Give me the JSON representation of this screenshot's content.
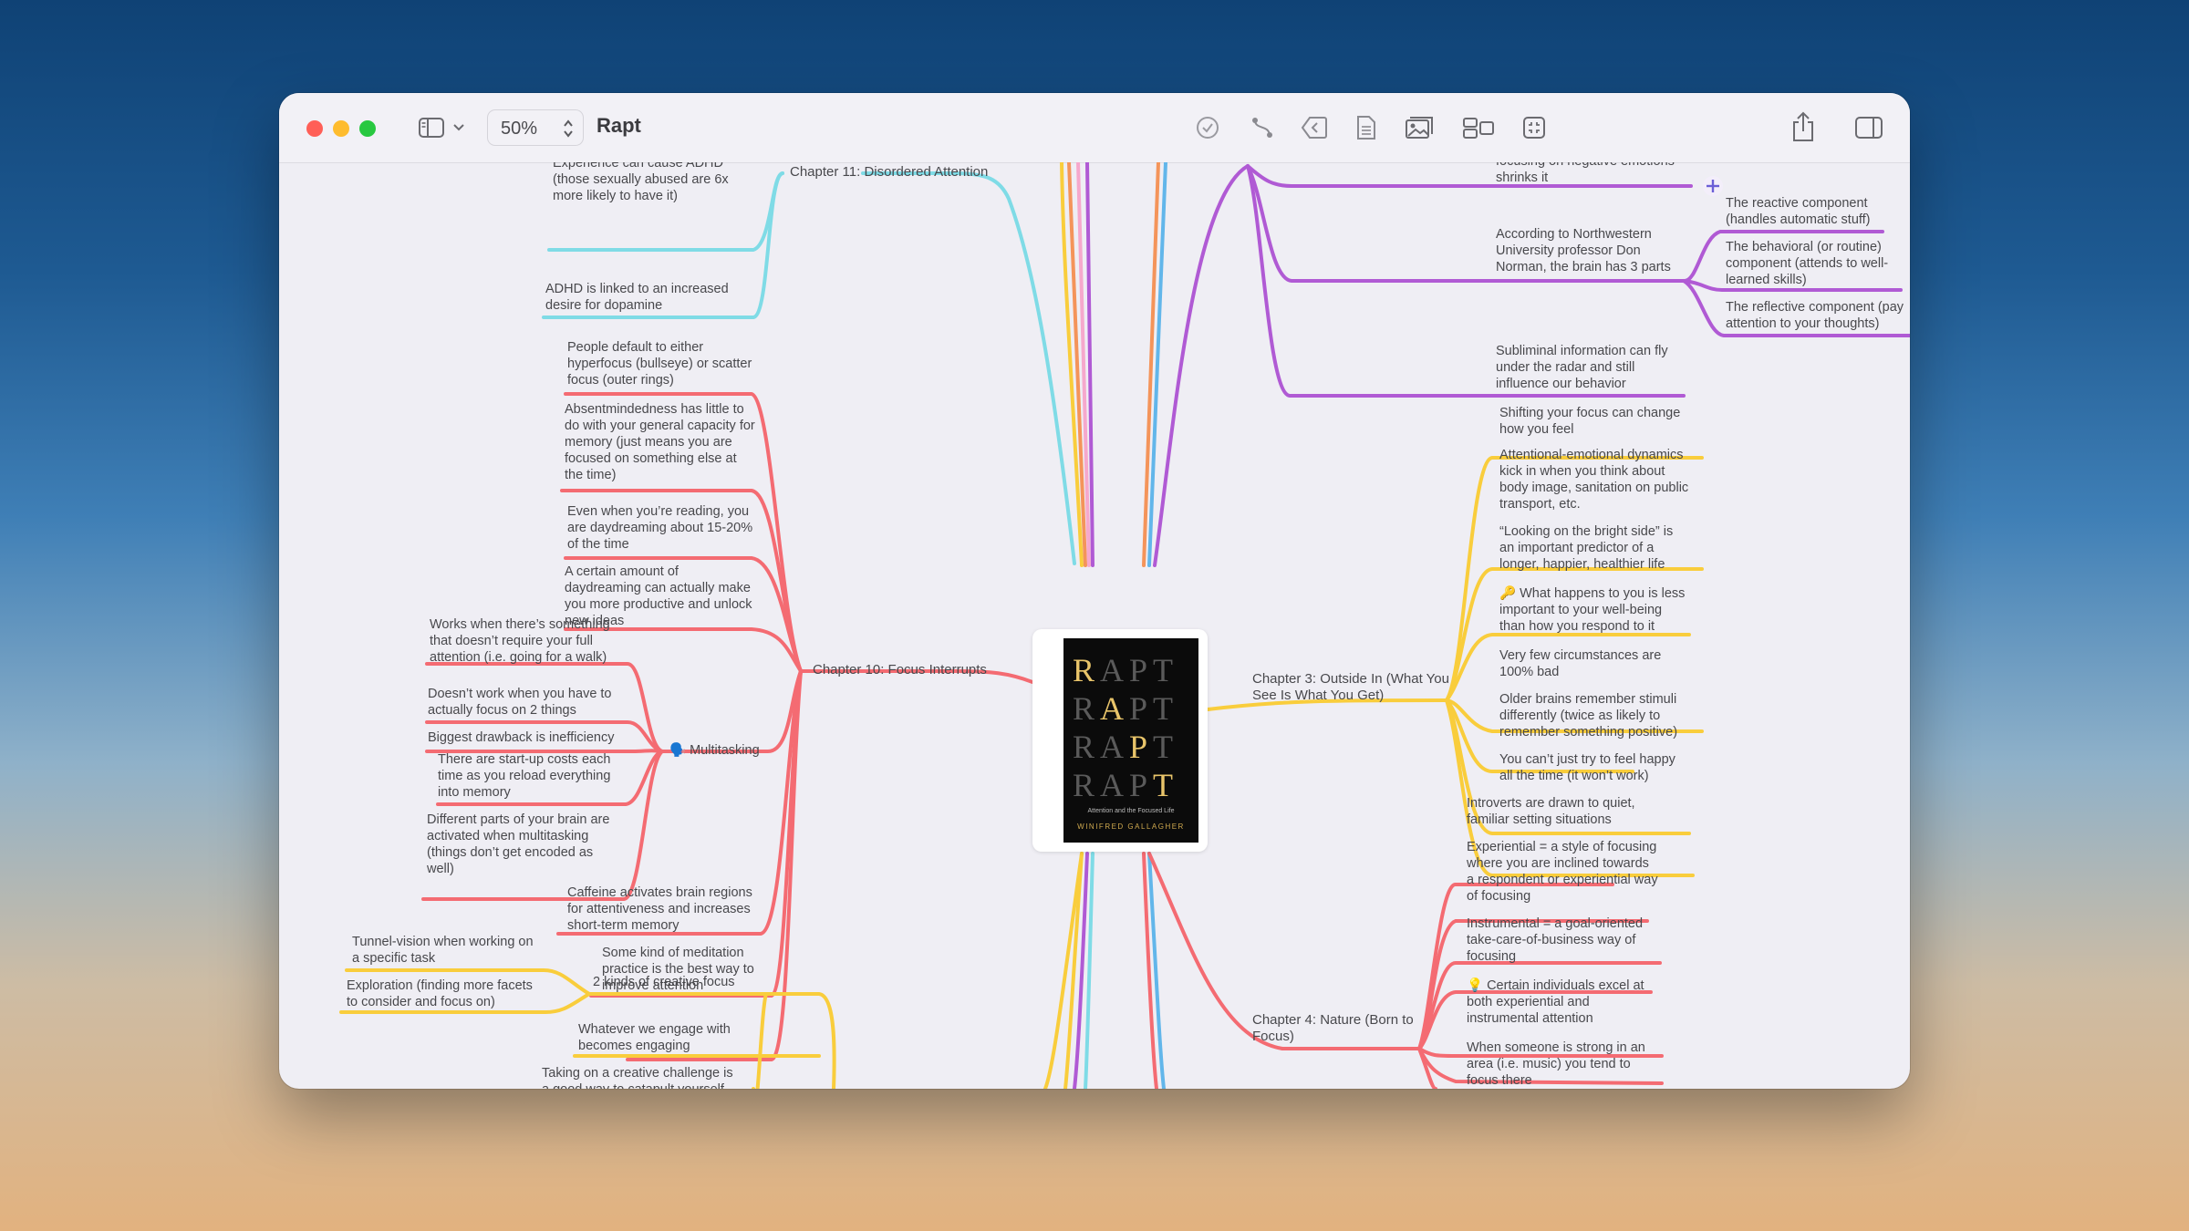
{
  "window": {
    "title": "Rapt",
    "zoom": "50%"
  },
  "toolbar": {
    "left_icons": [
      "sidebar-icon",
      "chevron-down-icon"
    ],
    "center_icons": [
      "checkmark-icon",
      "connection-icon",
      "back-icon",
      "note-icon",
      "image-icon",
      "layout-icon",
      "focus-icon"
    ],
    "right_icons": [
      "share-icon",
      "inspector-icon"
    ]
  },
  "colors": {
    "cyan": "#7fdbe6",
    "red": "#f46b72",
    "yellow": "#f9cd3c",
    "purple": "#b05ad4",
    "orange": "#f4945a",
    "blue": "#62b6ea",
    "background": "#efeef4"
  },
  "book": {
    "title_rows": [
      "RAPT",
      "RAPT",
      "RAPT",
      "RAPT"
    ],
    "subtitle": "Attention and the Focused Life",
    "author": "WINIFRED GALLAGHER"
  },
  "chapters": {
    "ch11": "Chapter 11: Disordered Attention",
    "ch10": "Chapter 10: Focus Interrupts",
    "ch3": [
      "Chapter 3: Outside In (What You",
      "See Is What You Get)"
    ],
    "ch4": [
      "Chapter 4: Nature (Born to",
      "Focus)"
    ]
  },
  "ch11_nodes": {
    "n1": [
      "Experience can cause ADHD",
      "(those sexually abused are 6x",
      "more likely to have it)"
    ],
    "n2": [
      "ADHD is linked to an increased",
      "desire for dopamine"
    ]
  },
  "ch10_nodes": {
    "n1": [
      "People default to either",
      "hyperfocus (bullseye) or scatter",
      "focus (outer rings)"
    ],
    "n2": [
      "Absentmindedness has little to",
      "do with your general capacity for",
      "memory (just means you are",
      "focused on something else at",
      "the time)"
    ],
    "n3": [
      "Even when you’re reading, you",
      "are daydreaming about 15-20%",
      "of the time"
    ],
    "n4": [
      "A certain amount of",
      "daydreaming can actually make",
      "you more productive and unlock",
      "new ideas"
    ],
    "multitasking": "🗣️ Multitasking",
    "m1": [
      "Works when there’s something",
      "that doesn’t require your full",
      "attention (i.e. going for a walk)"
    ],
    "m2": [
      "Doesn’t work when you have to",
      "actually focus on 2 things"
    ],
    "m3": [
      "Biggest drawback is inefficiency"
    ],
    "m4": [
      "There are start-up costs each",
      "time as you reload everything",
      "into memory"
    ],
    "m5": [
      "Different parts of your brain are",
      "activated when multitasking",
      "(things don’t get encoded as",
      "well)"
    ],
    "n5": [
      "Caffeine activates brain regions",
      "for attentiveness and increases",
      "short-term memory"
    ],
    "n6": [
      "Some kind of meditation",
      "practice is the best way to",
      "improve attention"
    ]
  },
  "creative_nodes": {
    "two_kinds": "2 kinds of creative focus",
    "c1": [
      "Tunnel-vision when working on",
      "a specific task"
    ],
    "c2": [
      "Exploration (finding more facets",
      "to consider and focus on)"
    ],
    "c3": [
      "Whatever we engage with",
      "becomes engaging"
    ],
    "c4": [
      "Taking on a creative challenge is",
      "a good way to catapult yourself"
    ]
  },
  "purple_nodes": {
    "p0": [
      "focusing on negative emotions",
      "shrinks it"
    ],
    "p1": [
      "According to Northwestern",
      "University professor Don",
      "Norman, the brain has 3 parts"
    ],
    "p1a": [
      "The reactive component",
      "(handles automatic stuff)"
    ],
    "p1b": [
      "The behavioral (or routine)",
      "component (attends to well-",
      "learned skills)"
    ],
    "p1c": [
      "The reflective component (pay",
      "attention to your thoughts)"
    ],
    "p2": [
      "Subliminal information can fly",
      "under the radar and still",
      "influence our behavior"
    ]
  },
  "ch3_nodes": {
    "n1": [
      "Shifting your focus can change",
      "how you feel"
    ],
    "n2": [
      "Attentional-emotional dynamics",
      "kick in when you think about",
      "body image, sanitation on public",
      "transport, etc."
    ],
    "n3": [
      "“Looking on the bright side” is",
      "an important predictor of a",
      "longer, happier, healthier life"
    ],
    "n4": [
      "🔑 What happens to you is less",
      "important to your well-being",
      "than how you respond to it"
    ],
    "n5": [
      "Very few circumstances are",
      "100% bad"
    ],
    "n6": [
      "Older brains remember stimuli",
      "differently (twice as likely to",
      "remember something positive)"
    ],
    "n7": [
      "You can’t just try to feel happy",
      "all the time (it won’t work)"
    ]
  },
  "ch4_nodes": {
    "n1": [
      "Introverts are drawn to quiet,",
      "familiar setting situations"
    ],
    "n2": [
      "Experiential = a style of focusing",
      "where you are inclined towards",
      "a respondent or experiential way",
      "of focusing"
    ],
    "n3": [
      "Instrumental = a goal-oriented",
      "take-care-of-business way of",
      "focusing"
    ],
    "n4": [
      "💡 Certain individuals excel at",
      "both experiential and",
      "instrumental attention"
    ],
    "n5": [
      "When someone is strong in an",
      "area (i.e. music) you tend to",
      "focus there"
    ]
  }
}
